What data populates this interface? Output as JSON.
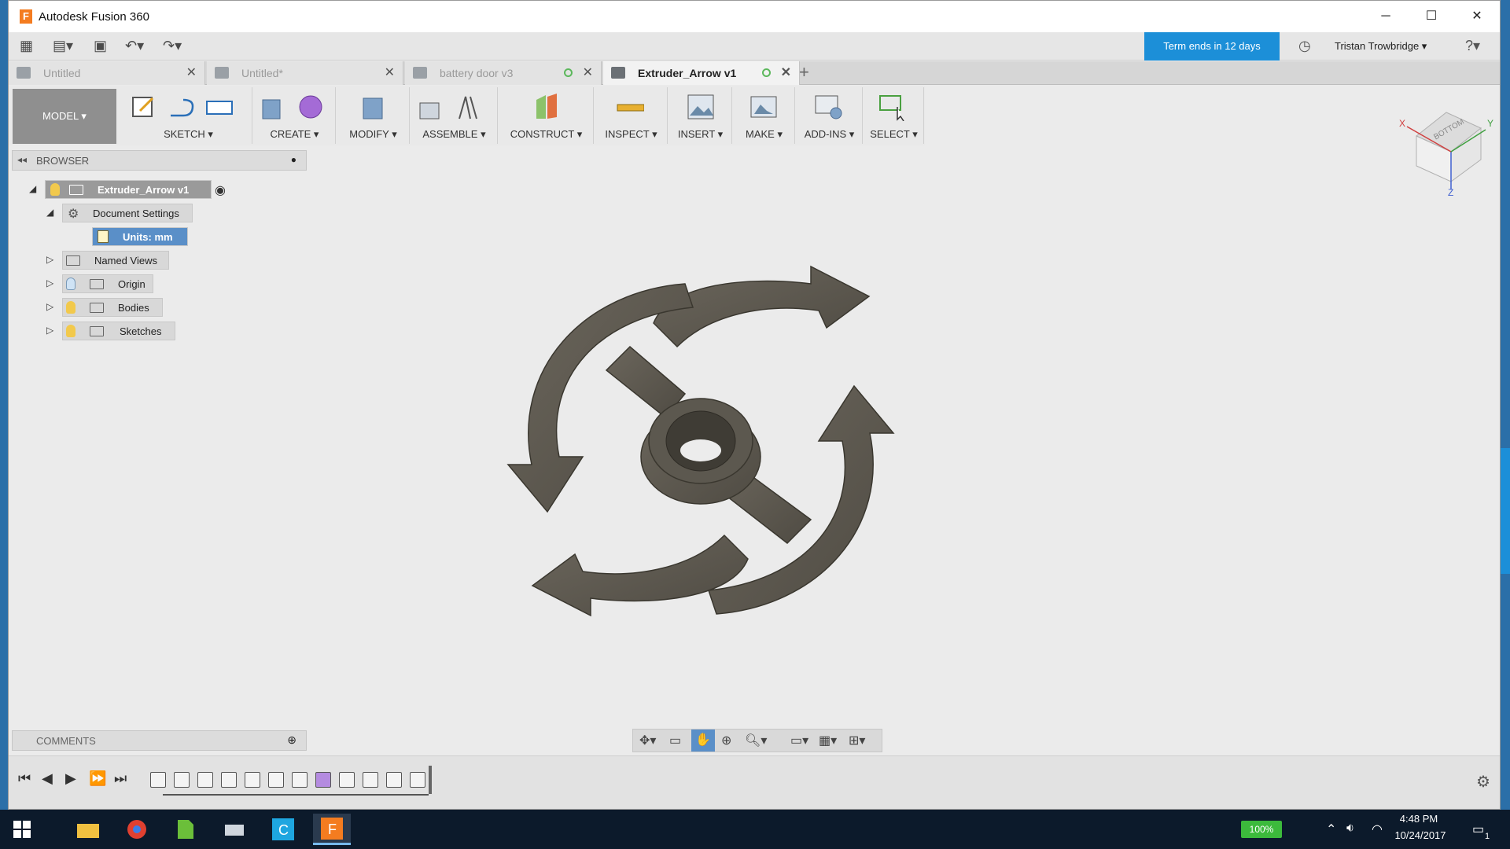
{
  "window": {
    "title": "Autodesk Fusion 360",
    "controls": [
      "─",
      "☐",
      "✕"
    ]
  },
  "qat": {
    "term": "Term ends in 12 days",
    "user": "Tristan Trowbridge ▾"
  },
  "tabs": [
    {
      "label": "Untitled",
      "active": false,
      "dot": false
    },
    {
      "label": "Untitled*",
      "active": false,
      "dot": false
    },
    {
      "label": "battery door v3",
      "active": false,
      "dot": true
    },
    {
      "label": "Extruder_Arrow v1",
      "active": true,
      "dot": true
    }
  ],
  "ribbon": {
    "workspace": "MODEL ▾",
    "groups": [
      "SKETCH ▾",
      "CREATE ▾",
      "MODIFY ▾",
      "ASSEMBLE ▾",
      "CONSTRUCT ▾",
      "INSPECT ▾",
      "INSERT ▾",
      "MAKE ▾",
      "ADD-INS ▾",
      "SELECT ▾"
    ]
  },
  "navcube": {
    "face": "BOTTOM",
    "axes": [
      "X",
      "Y",
      "Z"
    ]
  },
  "browser": {
    "title": "BROWSER",
    "root": "Extruder_Arrow v1",
    "doc_settings": "Document Settings",
    "units": "Units: mm",
    "named_views": "Named Views",
    "origin": "Origin",
    "bodies": "Bodies",
    "sketches": "Sketches"
  },
  "comments": {
    "title": "COMMENTS"
  },
  "taskbar": {
    "battery": "100%",
    "time": "4:48 PM",
    "date": "10/24/2017",
    "notifications": "1"
  },
  "colors": {
    "accent": "#1c8fd8",
    "model": "#5e5a52",
    "bulb": "#f2c94c"
  }
}
